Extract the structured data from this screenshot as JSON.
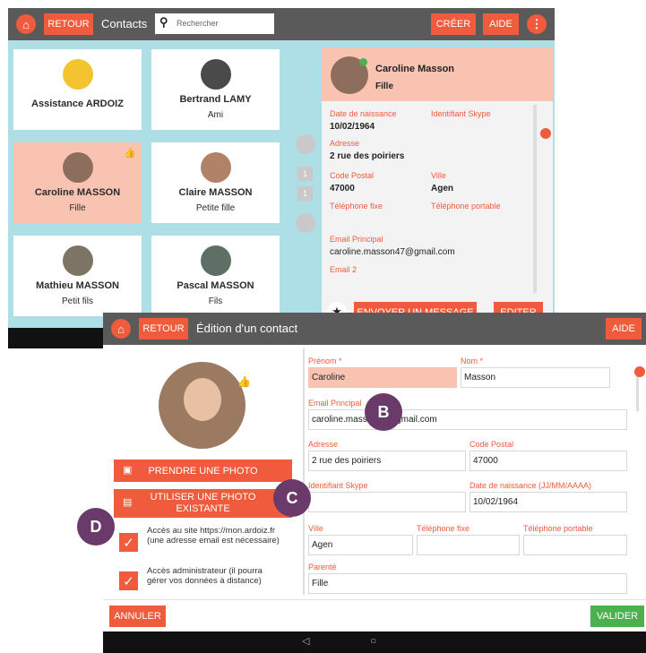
{
  "contacts_screen": {
    "toolbar": {
      "back_label": "RETOUR",
      "title": "Contacts",
      "search_placeholder": "Rechercher",
      "create_label": "CRÉER",
      "help_label": "AIDE"
    },
    "cards": [
      {
        "name": "Assistance ARDOIZ",
        "role": ""
      },
      {
        "name": "Bertrand LAMY",
        "role": "Ami"
      },
      {
        "name": "Caroline MASSON",
        "role": "Fille"
      },
      {
        "name": "Claire MASSON",
        "role": "Petite fille"
      },
      {
        "name": "Mathieu MASSON",
        "role": "Petit fils"
      },
      {
        "name": "Pascal MASSON",
        "role": "Fils"
      }
    ],
    "pager": [
      "1",
      "1"
    ],
    "detail": {
      "name": "Caroline Masson",
      "role": "Fille",
      "dob_label": "Date de naissance",
      "dob": "10/02/1964",
      "skype_label": "Identifiant Skype",
      "address_label": "Adresse",
      "address": "2 rue des poiriers",
      "postal_label": "Code Postal",
      "postal": "47000",
      "city_label": "Ville",
      "city": "Agen",
      "phone_label": "Téléphone fixe",
      "mobile_label": "Téléphone portable",
      "email_label": "Email Principal",
      "email": "caroline.masson47@gmail.com",
      "email2_label": "Email 2",
      "send_label": "ENVOYER UN MESSAGE",
      "edit_label": "EDITER"
    }
  },
  "edit_screen": {
    "toolbar": {
      "back_label": "RETOUR",
      "title": "Édition d'un contact",
      "help_label": "AIDE"
    },
    "take_photo_label": "PRENDRE UNE PHOTO",
    "use_photo_label_1": "UTILISER UNE PHOTO",
    "use_photo_label_2": "EXISTANTE",
    "site_access": "Accès au site https://mon.ardoiz.fr (une adresse email est nécessaire)",
    "admin_access": "Accès administrateur (il pourra gérer vos données à distance)",
    "fields": {
      "first_name_label": "Prénom *",
      "first_name": "Caroline",
      "last_name_label": "Nom *",
      "last_name": "Masson",
      "email_label": "Email Principal",
      "email": "caroline.masson47@gmail.com",
      "address_label": "Adresse",
      "address": "2 rue des poiriers",
      "postal_label": "Code Postal",
      "postal": "47000",
      "skype_label": "Identifiant Skype",
      "dob_label": "Date de naissance (JJ/MM/AAAA)",
      "dob": "10/02/1964",
      "city_label": "Ville",
      "city": "Agen",
      "phone_label": "Téléphone fixe",
      "mobile_label": "Téléphone portable",
      "relation_label": "Parenté",
      "relation": "Fille"
    },
    "cancel_label": "ANNULER",
    "validate_label": "VALIDER",
    "markers": {
      "b": "B",
      "c": "C",
      "d": "D"
    }
  }
}
